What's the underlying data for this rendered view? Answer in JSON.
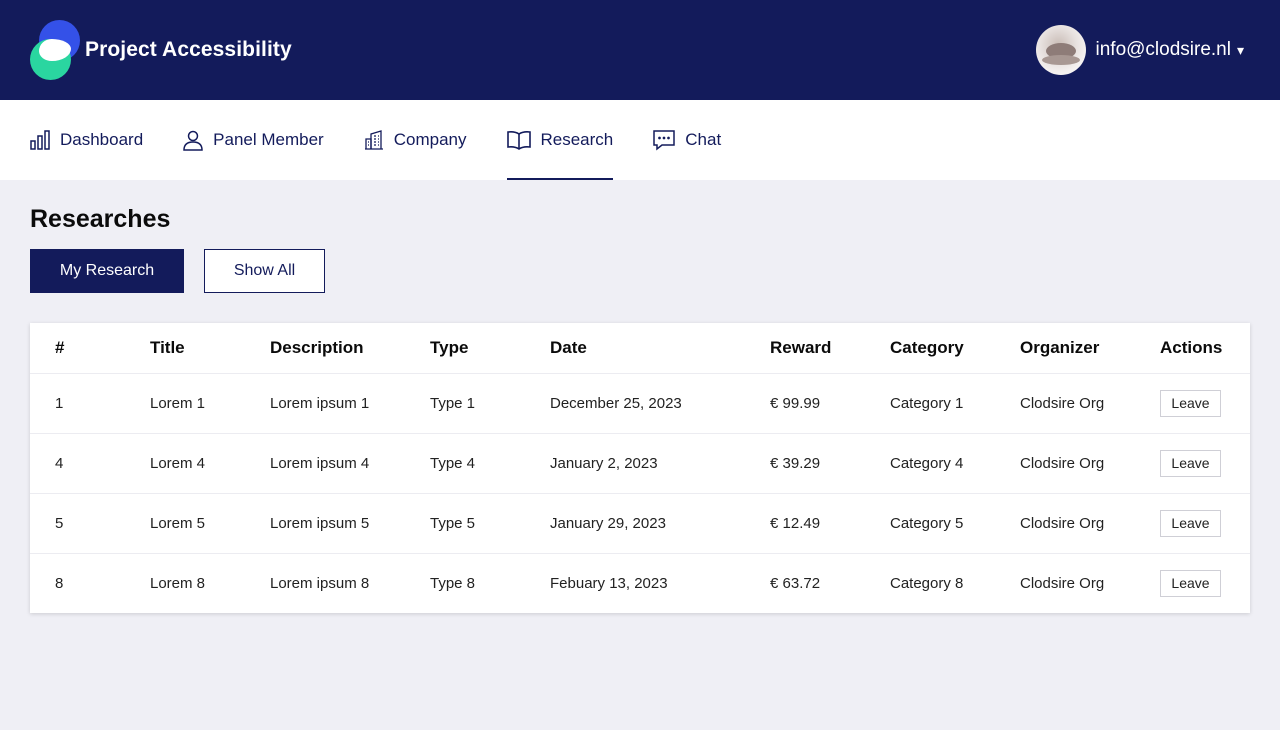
{
  "header": {
    "brand_title": "Project Accessibility",
    "user_email": "info@clodsire.nl",
    "caret": "▾",
    "colors": {
      "bar": "#131b5b",
      "logo_blue": "#3451e8",
      "logo_green": "#2ad6a0"
    }
  },
  "nav": {
    "items": [
      {
        "label": "Dashboard",
        "icon": "bar-chart-icon"
      },
      {
        "label": "Panel Member",
        "icon": "user-icon"
      },
      {
        "label": "Company",
        "icon": "building-icon"
      },
      {
        "label": "Research",
        "icon": "book-icon",
        "active": true
      },
      {
        "label": "Chat",
        "icon": "chat-icon"
      }
    ]
  },
  "main": {
    "title": "Researches",
    "my_research_label": "My Research",
    "show_all_label": "Show All"
  },
  "table": {
    "headers": [
      "#",
      "Title",
      "Description",
      "Type",
      "Date",
      "Reward",
      "Category",
      "Organizer",
      "Actions"
    ],
    "rows": [
      {
        "num": "1",
        "title": "Lorem 1",
        "description": "Lorem ipsum 1",
        "type": "Type 1",
        "date": "December 25, 2023",
        "reward": "€ 99.99",
        "category": "Category 1",
        "organizer": "Clodsire Org",
        "action": "Leave"
      },
      {
        "num": "4",
        "title": "Lorem 4",
        "description": "Lorem ipsum 4",
        "type": "Type 4",
        "date": "January 2, 2023",
        "reward": "€ 39.29",
        "category": "Category 4",
        "organizer": "Clodsire Org",
        "action": "Leave"
      },
      {
        "num": "5",
        "title": "Lorem 5",
        "description": "Lorem ipsum 5",
        "type": "Type 5",
        "date": "January 29, 2023",
        "reward": "€ 12.49",
        "category": "Category 5",
        "organizer": "Clodsire Org",
        "action": "Leave"
      },
      {
        "num": "8",
        "title": "Lorem 8",
        "description": "Lorem ipsum 8",
        "type": "Type 8",
        "date": "Febuary 13, 2023",
        "reward": "€ 63.72",
        "category": "Category 8",
        "organizer": "Clodsire Org",
        "action": "Leave"
      }
    ]
  }
}
